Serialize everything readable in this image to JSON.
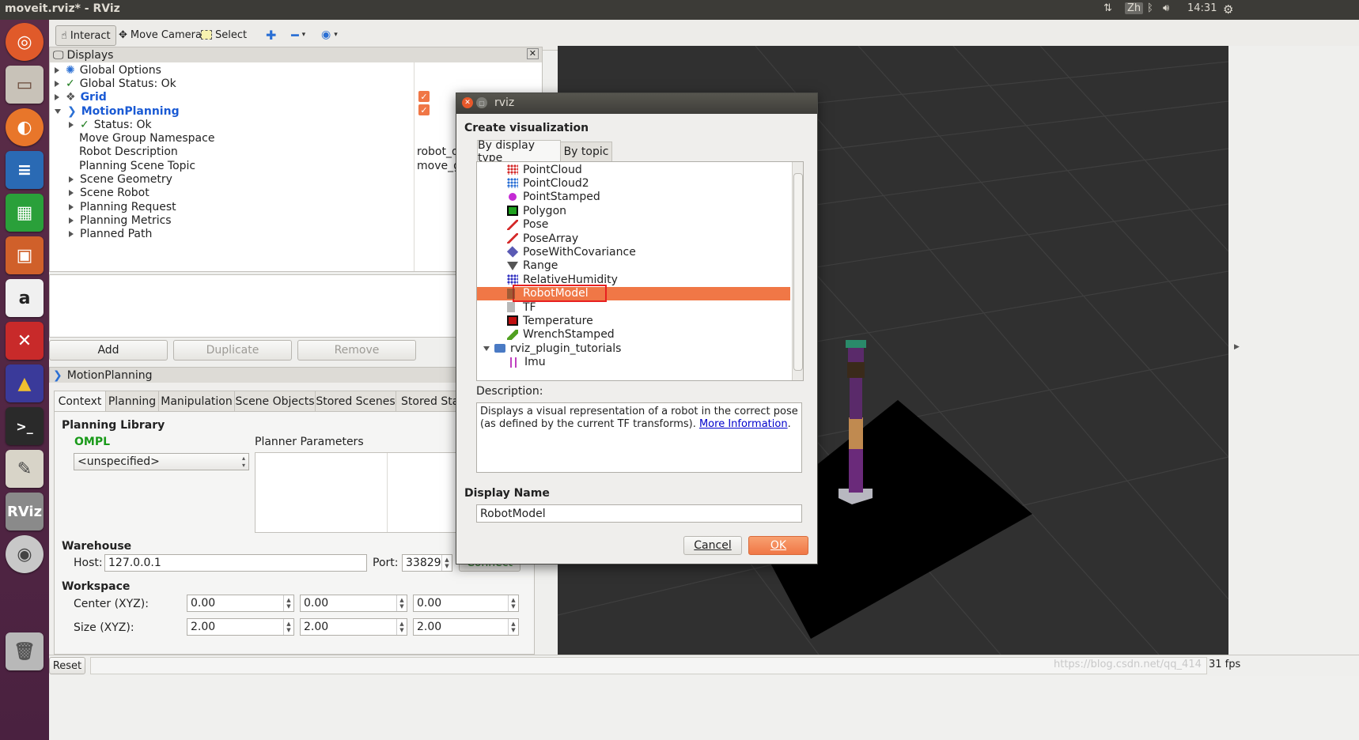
{
  "window": {
    "title": "moveit.rviz* - RViz"
  },
  "tray": {
    "lang": "Zh",
    "time": "14:31"
  },
  "toolbar": {
    "interact": "Interact",
    "move_camera": "Move Camera",
    "select": "Select"
  },
  "displays": {
    "title": "Displays",
    "items": [
      {
        "label": "Global Options"
      },
      {
        "label": "Global Status: Ok"
      },
      {
        "label": "Grid"
      },
      {
        "label": "MotionPlanning"
      },
      {
        "label": "Status: Ok"
      },
      {
        "label": "Move Group Namespace"
      },
      {
        "label": "Robot Description",
        "value": "robot_d"
      },
      {
        "label": "Planning Scene Topic",
        "value": "move_g"
      },
      {
        "label": "Scene Geometry"
      },
      {
        "label": "Scene Robot"
      },
      {
        "label": "Planning Request"
      },
      {
        "label": "Planning Metrics"
      },
      {
        "label": "Planned Path"
      }
    ],
    "buttons": {
      "add": "Add",
      "duplicate": "Duplicate",
      "remove": "Remove"
    }
  },
  "motion_panel": {
    "title": "MotionPlanning",
    "tabs": [
      "Context",
      "Planning",
      "Manipulation",
      "Scene Objects",
      "Stored Scenes",
      "Stored Stat"
    ],
    "planning_library": "Planning Library",
    "ompl": "OMPL",
    "planner_select": "<unspecified>",
    "planner_params": "Planner Parameters",
    "warehouse": "Warehouse",
    "host_label": "Host:",
    "host_value": "127.0.0.1",
    "port_label": "Port:",
    "port_value": "33829",
    "connect": "Connect",
    "workspace": "Workspace",
    "center_label": "Center (XYZ):",
    "size_label": "Size (XYZ):",
    "center": [
      "0.00",
      "0.00",
      "0.00"
    ],
    "size": [
      "2.00",
      "2.00",
      "2.00"
    ]
  },
  "status": {
    "reset": "Reset",
    "fps": "31 fps",
    "watermark": "https://blog.csdn.net/qq_414"
  },
  "dialog": {
    "title": "rviz",
    "heading": "Create visualization",
    "tab_by_type": "By display type",
    "tab_by_topic": "By topic",
    "list": [
      {
        "label": "PointCloud",
        "icon": "pointcloud-icon",
        "color": "#d42a2a"
      },
      {
        "label": "PointCloud2",
        "icon": "pointcloud2-icon",
        "color": "#2a6fd4"
      },
      {
        "label": "PointStamped",
        "icon": "pointstamped-icon",
        "color": "#c42ad4"
      },
      {
        "label": "Polygon",
        "icon": "polygon-icon",
        "color": "#1ea01e"
      },
      {
        "label": "Pose",
        "icon": "pose-icon",
        "color": "#d42a2a"
      },
      {
        "label": "PoseArray",
        "icon": "posearray-icon",
        "color": "#d42a2a"
      },
      {
        "label": "PoseWithCovariance",
        "icon": "posewithcovariance-icon",
        "color": "#5a5ab4"
      },
      {
        "label": "Range",
        "icon": "range-icon",
        "color": "#555555"
      },
      {
        "label": "RelativeHumidity",
        "icon": "relativehumidity-icon",
        "color": "#3030c0"
      },
      {
        "label": "RobotModel",
        "icon": "robotmodel-icon",
        "color": "#6a4a2a",
        "selected": true
      },
      {
        "label": "TF",
        "icon": "tf-icon",
        "color": "#888888"
      },
      {
        "label": "Temperature",
        "icon": "temperature-icon",
        "color": "#c01010"
      },
      {
        "label": "WrenchStamped",
        "icon": "wrenchstamped-icon",
        "color": "#50a020"
      },
      {
        "label": "rviz_plugin_tutorials",
        "icon": "folder-icon",
        "color": "#4a7ac4",
        "folder": true
      },
      {
        "label": "Imu",
        "icon": "imu-icon",
        "color": "#c040c0",
        "child": true
      }
    ],
    "description_label": "Description:",
    "description_text": "Displays a visual representation of a robot in the correct pose (as defined by the current TF transforms). ",
    "description_link": "More Information",
    "display_name_label": "Display Name",
    "display_name_value": "RobotModel",
    "cancel": "Cancel",
    "ok": "OK"
  },
  "colors": {
    "accent": "#f07746",
    "selection": "#f07746",
    "link": "#0000cc",
    "launcher": "#5b2d48",
    "viewport": "#303030"
  }
}
